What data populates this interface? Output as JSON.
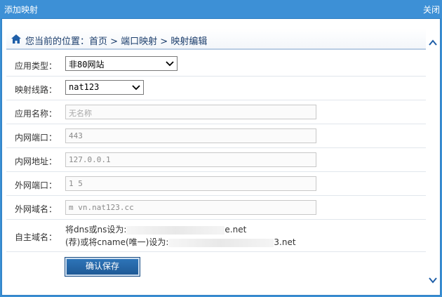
{
  "window": {
    "title": "添加映射",
    "close_label": "关闭"
  },
  "breadcrumb": {
    "text": "您当前的位置：首页 > 端口映射 > 映射编辑"
  },
  "form": {
    "app_type": {
      "label": "应用类型：",
      "value": "非80网站"
    },
    "route": {
      "label": "映射线路：",
      "value": "nat123"
    },
    "app_name": {
      "label": "应用名称：",
      "placeholder": "无名称"
    },
    "lan_port": {
      "label": "内网端口：",
      "value": "443"
    },
    "lan_addr": {
      "label": "内网地址：",
      "value": "127.0.0.1"
    },
    "wan_port": {
      "label": "外网端口：",
      "value": "1  5"
    },
    "wan_domain": {
      "label": "外网域名：",
      "value": "m    vn.nat123.cc"
    },
    "custom_domain": {
      "label": "自主域名：",
      "line1_prefix": "将dns或ns设为:",
      "line1_suffix": "e.net",
      "line2_prefix": "(荐)或将cname(唯一)设为:",
      "line2_suffix": "3.net"
    },
    "submit_label": "确认保存"
  },
  "icons": {
    "home": "home-icon",
    "scroll_up": "chevron-up-icon",
    "scroll_down": "chevron-down-icon"
  },
  "colors": {
    "titlebar": "#3d90d6",
    "button": "#2566a8",
    "breadcrumb_text": "#1c3e6c"
  }
}
